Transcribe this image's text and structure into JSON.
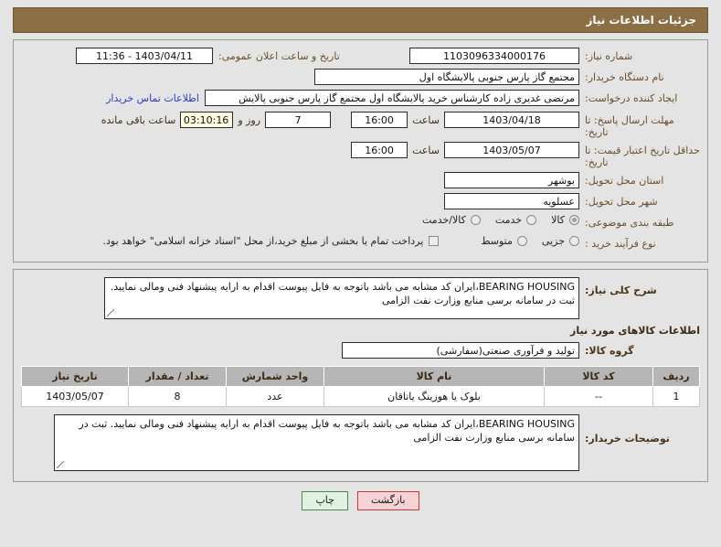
{
  "header": {
    "title": "جزئیات اطلاعات نیاز"
  },
  "top": {
    "need_number_label": "شماره نیاز:",
    "need_number_value": "1103096334000176",
    "announce_label": "تاریخ و ساعت اعلان عمومی:",
    "announce_value": "1403/04/11 - 11:36",
    "buyer_org_label": "نام دستگاه خریدار:",
    "buyer_org_value": "مجتمع گاز پارس جنوبی  پالایشگاه اول",
    "creator_label": "ایجاد کننده درخواست:",
    "creator_value": "مرتضی غدیری زاده کارشناس خرید پالایشگاه اول مجتمع گاز پارس جنوبی  پالایش",
    "contact_link": "اطلاعات تماس خریدار",
    "deadline_label": "مهلت ارسال پاسخ: تا تاریخ:",
    "deadline_date": "1403/04/18",
    "deadline_time_label": "ساعت",
    "deadline_time": "16:00",
    "remaining_days": "7",
    "remaining_days_label": "روز و",
    "remaining_clock": "03:10:16",
    "remaining_suffix": "ساعت باقی مانده",
    "validity_label": "حداقل تاریخ اعتبار قیمت: تا تاریخ:",
    "validity_date": "1403/05/07",
    "validity_time_label": "ساعت",
    "validity_time": "16:00",
    "province_label": "استان محل تحویل:",
    "province_value": "بوشهر",
    "city_label": "شهر محل تحویل:",
    "city_value": "عسلویه",
    "category_label": "طبقه بندی موضوعی:",
    "category_options": [
      {
        "label": "کالا",
        "selected": true
      },
      {
        "label": "خدمت",
        "selected": false
      },
      {
        "label": "کالا/خدمت",
        "selected": false
      }
    ],
    "process_label": "نوع فرآیند خرید :",
    "process_options": [
      {
        "label": "جزیی",
        "selected": false
      },
      {
        "label": "متوسط",
        "selected": false
      }
    ],
    "treasury_checkbox_label": "پرداخت تمام یا بخشی از مبلغ خرید،از محل \"اسناد خزانه اسلامی\" خواهد بود.",
    "treasury_checked": false
  },
  "summary": {
    "label": "شرح کلی نیاز:",
    "value": "BEARING HOUSING،ایران کد مشابه می باشد باتوجه به فایل پیوست اقدام به ارایه پیشنهاد فنی ومالی نمایید. ثبت در سامانه برسی منابع وزارت نفت الزامی"
  },
  "goods_section": {
    "heading": "اطلاعات کالاهای مورد نیاز",
    "group_label": "گروه کالا:",
    "group_value": "تولید و فرآوری صنعتی(سفارشی)",
    "columns": [
      "ردیف",
      "کد کالا",
      "نام کالا",
      "واحد شمارش",
      "تعداد / مقدار",
      "تاریخ نیاز"
    ],
    "rows": [
      {
        "index": "1",
        "code": "--",
        "name": "بلوک یا هوزینگ یاتاقان",
        "unit": "عدد",
        "qty": "8",
        "need_date": "1403/05/07"
      }
    ]
  },
  "buyer_notes": {
    "label": "توضیحات خریدار:",
    "value": "BEARING HOUSING،ایران کد مشابه می باشد باتوجه به فایل پیوست اقدام به ارایه پیشنهاد فنی ومالی نمایید. ثبت در سامانه برسی منابع وزارت نفت الزامی"
  },
  "buttons": {
    "back": "بازگشت",
    "print": "چاپ"
  },
  "colors": {
    "title_bar": "#8d6f46",
    "label_brown": "#6b4f2a",
    "link_blue": "#2b3ec4",
    "table_header": "#b6b6b6",
    "back_button_bg": "#f8d3d6",
    "print_button_bg": "#e2f2e2",
    "countdown_bg": "#fffce0"
  }
}
